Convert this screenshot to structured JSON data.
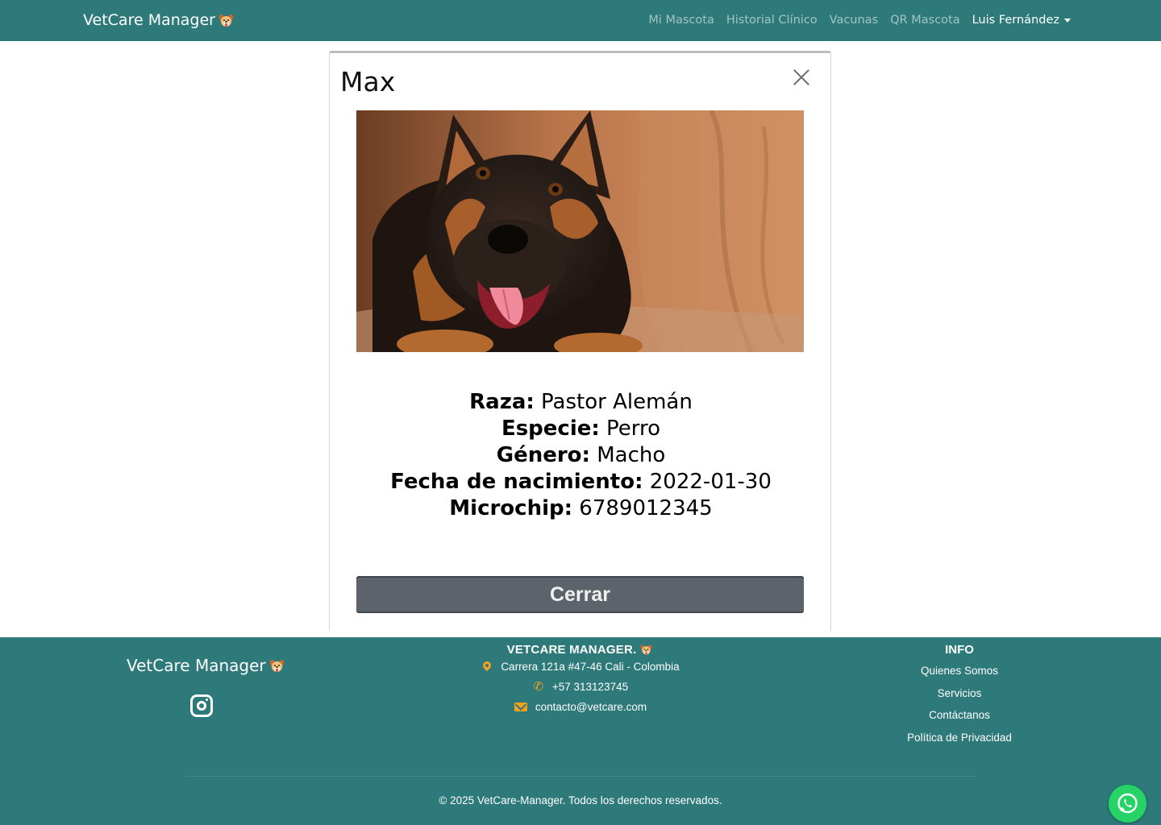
{
  "navbar": {
    "brand": "VetCare Manager",
    "brand_icon": "dog-face-emoji",
    "links": [
      "Mi Mascota",
      "Historial Clínico",
      "Vacunas",
      "QR Mascota"
    ],
    "user": "Luis Fernández"
  },
  "modal": {
    "title": "Max",
    "photo_alt": "german-shepherd-puppy",
    "fields": [
      {
        "label": "Raza:",
        "value": "Pastor Alemán"
      },
      {
        "label": "Especie:",
        "value": "Perro"
      },
      {
        "label": "Género:",
        "value": "Macho"
      },
      {
        "label": "Fecha de nacimiento:",
        "value": "2022-01-30"
      },
      {
        "label": "Microchip:",
        "value": "6789012345"
      }
    ],
    "close_button": "Cerrar"
  },
  "footer": {
    "brand": "VetCare Manager",
    "mid_title": "VETCARE MANAGER.",
    "address": "Carrera 121a #47-46 Cali - Colombia",
    "phone": "+57 313123745",
    "email": "contacto@vetcare.com",
    "info_title": "INFO",
    "info_links": [
      "Quienes Somos",
      "Servicios",
      "Contáctanos",
      "Política de Privacidad"
    ],
    "copyright": "© 2025 VetCare-Manager. Todos los derechos reservados."
  },
  "colors": {
    "primary": "#2e7a7b",
    "accent": "#f5a11c",
    "button_secondary": "#5c636a",
    "whatsapp": "#25d366"
  }
}
